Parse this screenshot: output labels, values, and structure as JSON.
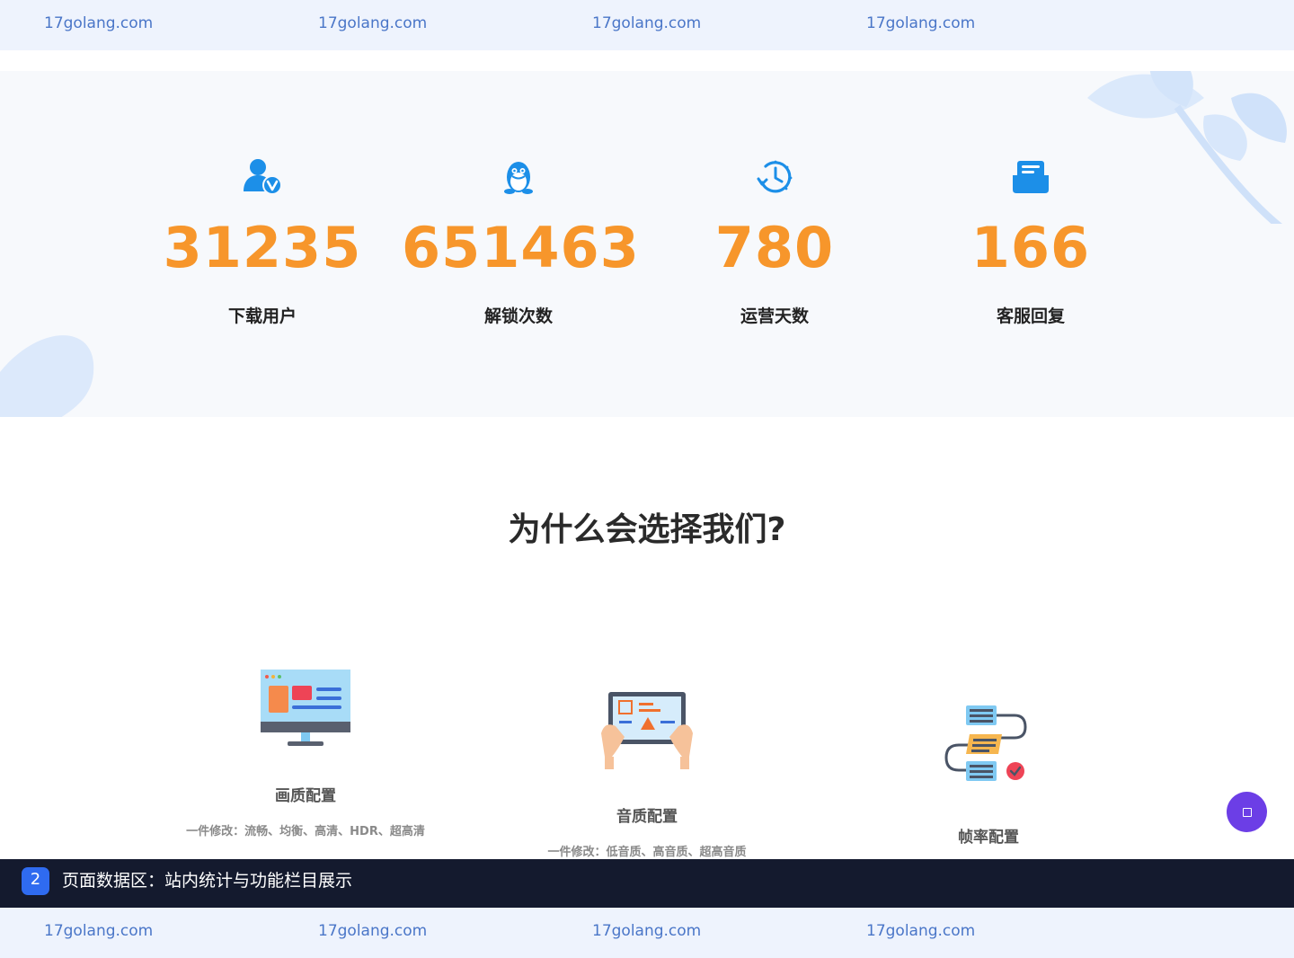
{
  "watermark": {
    "top": [
      "17golang.com",
      "17golang.com",
      "17golang.com",
      "17golang.com"
    ],
    "bottom": [
      "17golang.com",
      "17golang.com",
      "17golang.com",
      "17golang.com"
    ]
  },
  "stats": [
    {
      "icon": "verified-user-icon",
      "value": "31235",
      "label": "下载用户"
    },
    {
      "icon": "qq-penguin-icon",
      "value": "651463",
      "label": "解锁次数"
    },
    {
      "icon": "clock-history-icon",
      "value": "780",
      "label": "运营天数"
    },
    {
      "icon": "mail-inbox-icon",
      "value": "166",
      "label": "客服回复"
    }
  ],
  "section_title": "为什么会选择我们?",
  "features": [
    {
      "icon": "monitor-illustration-icon",
      "title": "画质配置",
      "desc": "一件修改：流畅、均衡、高清、HDR、超高清"
    },
    {
      "icon": "tablet-hands-illustration-icon",
      "title": "音质配置",
      "desc": "一件修改：低音质、高音质、超高音质"
    },
    {
      "icon": "flowchart-illustration-icon",
      "title": "帧率配置",
      "desc": ""
    }
  ],
  "caption": {
    "badge": "2",
    "text": "页面数据区：站内统计与功能栏目展示"
  },
  "colors": {
    "accent_orange": "#f7962b",
    "icon_blue": "#1c8fe8",
    "caption_bg": "#141a2e",
    "badge_blue": "#2f6bf0",
    "float_button": "#6c3ee6"
  }
}
